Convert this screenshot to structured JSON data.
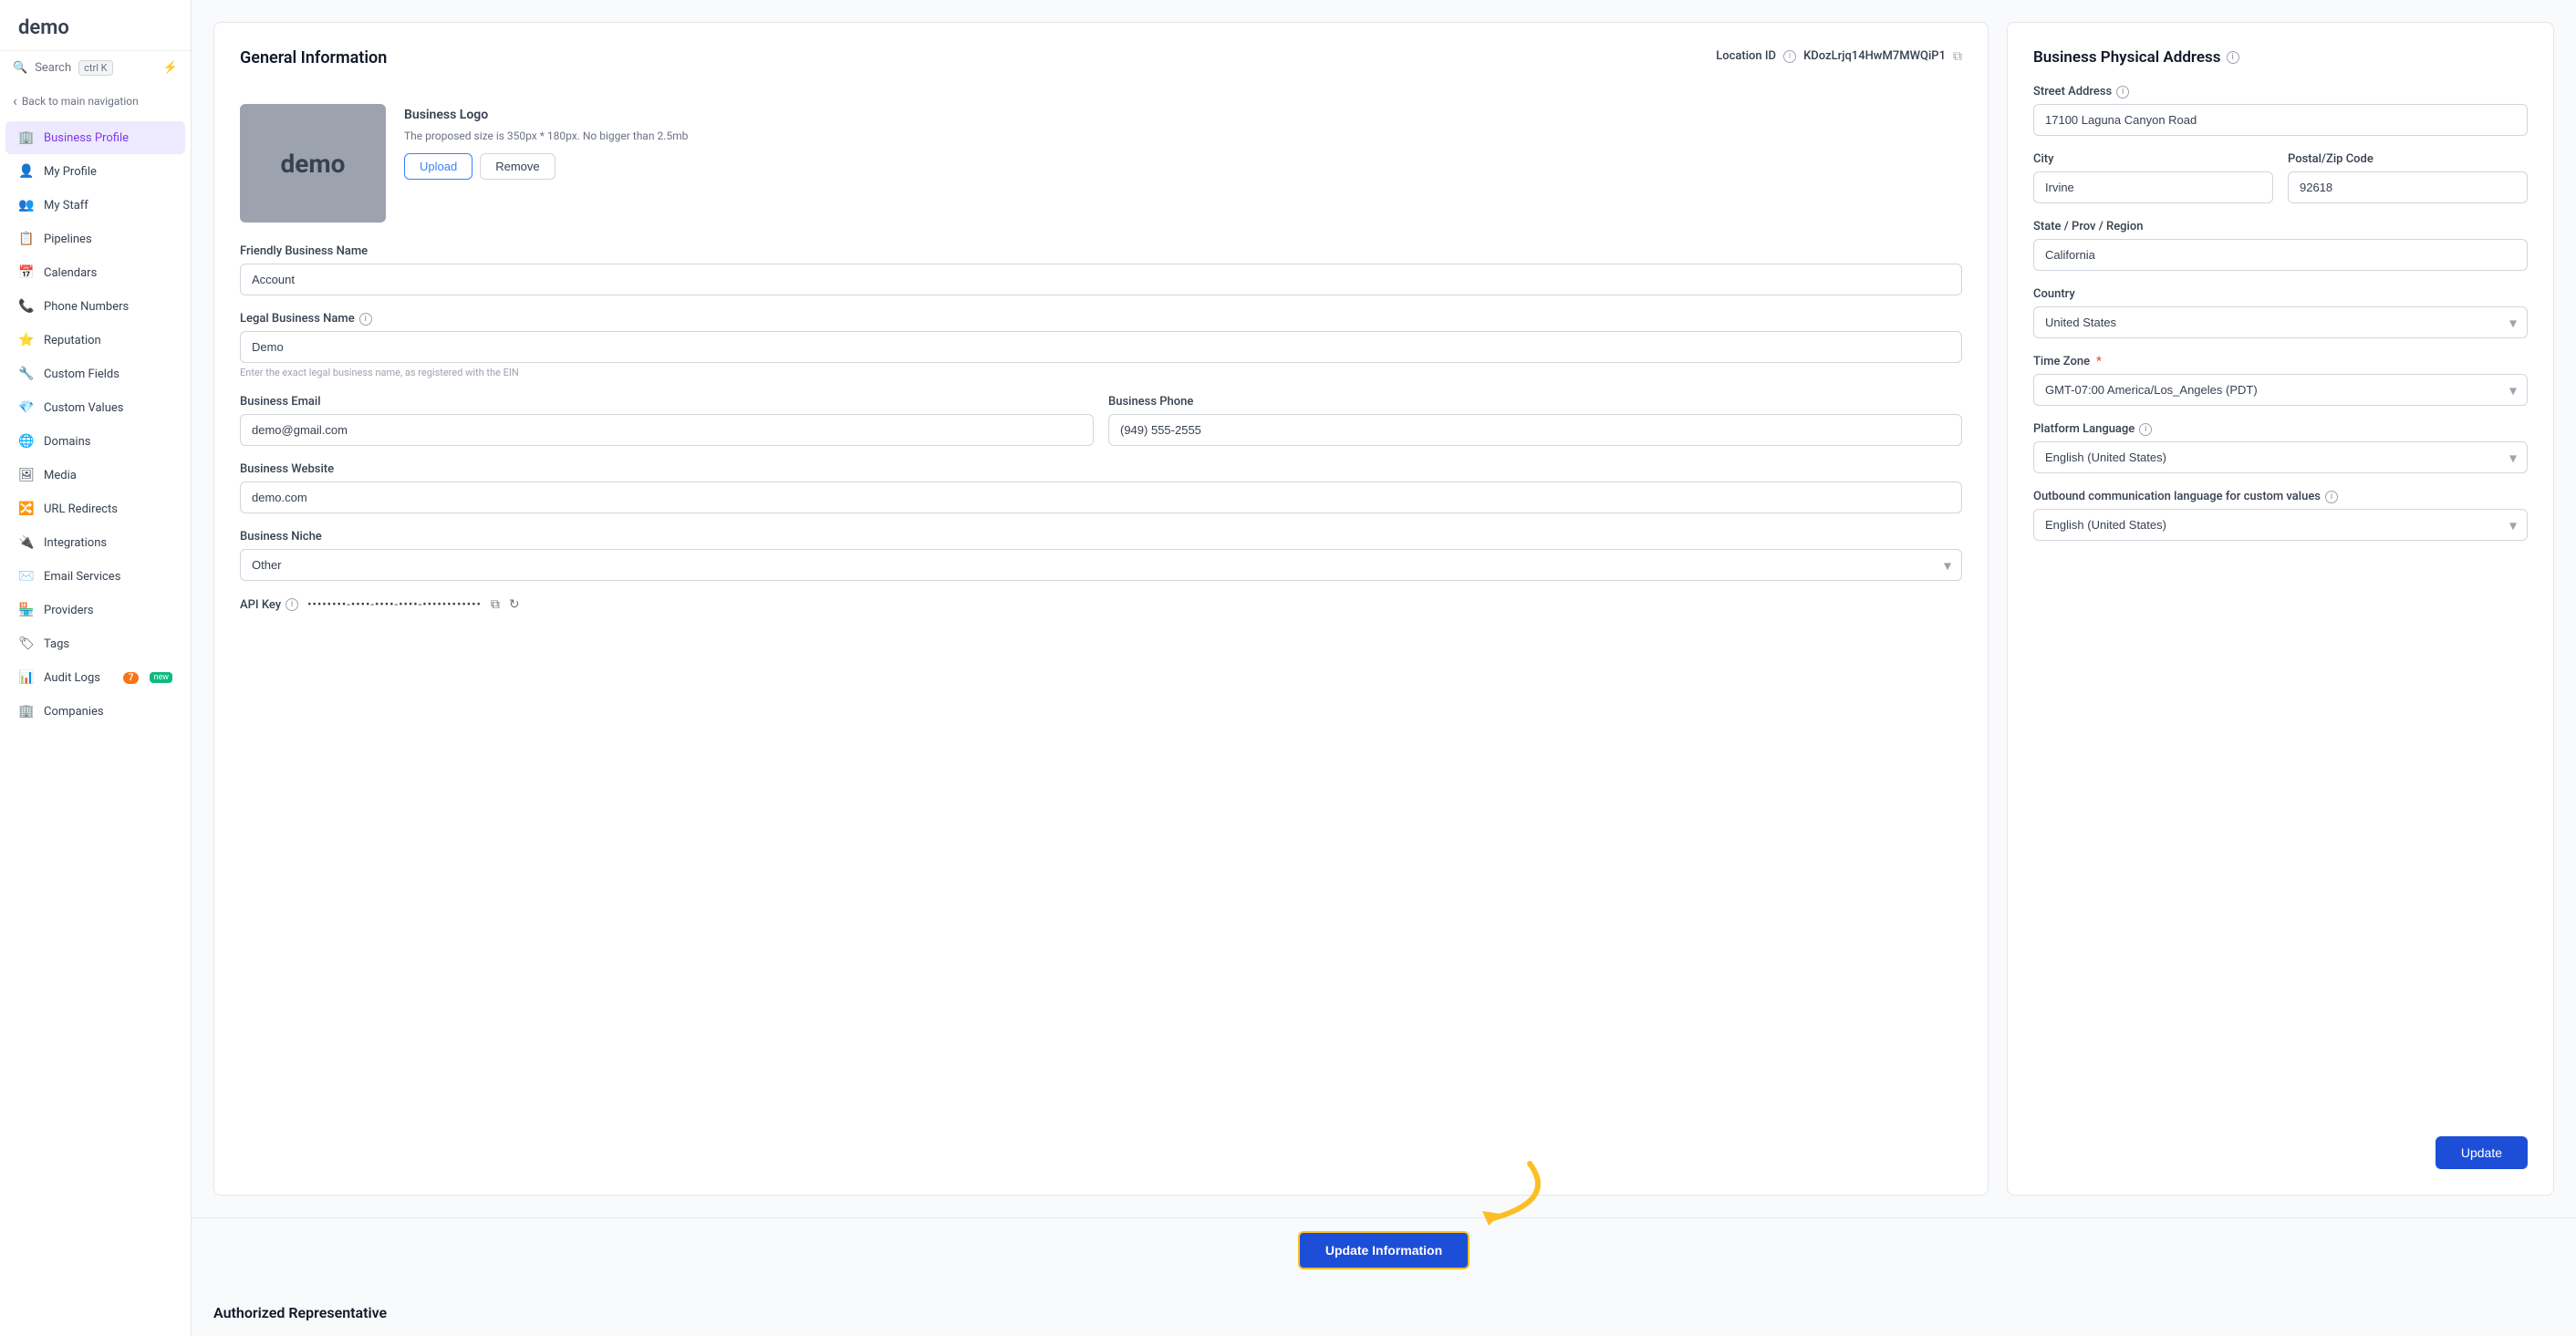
{
  "sidebar": {
    "logo": "demo",
    "search_label": "Search",
    "search_shortcut": "ctrl K",
    "back_label": "Back to main navigation",
    "items": [
      {
        "id": "business-profile",
        "label": "Business Profile",
        "icon": "🏢",
        "active": true
      },
      {
        "id": "my-profile",
        "label": "My Profile",
        "icon": "👤"
      },
      {
        "id": "my-staff",
        "label": "My Staff",
        "icon": "👥"
      },
      {
        "id": "pipelines",
        "label": "Pipelines",
        "icon": "📋"
      },
      {
        "id": "calendars",
        "label": "Calendars",
        "icon": "📅"
      },
      {
        "id": "phone-numbers",
        "label": "Phone Numbers",
        "icon": "📞"
      },
      {
        "id": "reputation",
        "label": "Reputation",
        "icon": "⭐"
      },
      {
        "id": "custom-fields",
        "label": "Custom Fields",
        "icon": "🔧"
      },
      {
        "id": "custom-values",
        "label": "Custom Values",
        "icon": "💎"
      },
      {
        "id": "domains",
        "label": "Domains",
        "icon": "🌐"
      },
      {
        "id": "media",
        "label": "Media",
        "icon": "🖼"
      },
      {
        "id": "url-redirects",
        "label": "URL Redirects",
        "icon": "🔀"
      },
      {
        "id": "integrations",
        "label": "Integrations",
        "icon": "🔌"
      },
      {
        "id": "email-services",
        "label": "Email Services",
        "icon": "✉️"
      },
      {
        "id": "providers",
        "label": "Providers",
        "icon": "🏪"
      },
      {
        "id": "tags",
        "label": "Tags",
        "icon": "🏷"
      },
      {
        "id": "audit-logs",
        "label": "Audit Logs",
        "icon": "📊",
        "badge": "7",
        "badge_new": "new"
      },
      {
        "id": "companies",
        "label": "Companies",
        "icon": "🏢"
      }
    ]
  },
  "general_information": {
    "title": "General Information",
    "location_id_label": "Location ID",
    "location_id_value": "KDozLrjq14HwM7MWQiP1",
    "logo_section": {
      "title": "Business Logo",
      "hint": "The proposed size is 350px * 180px. No bigger than 2.5mb",
      "upload_label": "Upload",
      "remove_label": "Remove",
      "preview_text": "demo"
    },
    "friendly_business_name_label": "Friendly Business Name",
    "friendly_business_name_value": "Account",
    "legal_business_name_label": "Legal Business Name",
    "legal_business_name_value": "Demo",
    "legal_business_name_hint": "Enter the exact legal business name, as registered with the EIN",
    "business_email_label": "Business Email",
    "business_email_value": "demo@gmail.com",
    "business_phone_label": "Business Phone",
    "business_phone_value": "(949) 555-2555",
    "business_website_label": "Business Website",
    "business_website_value": "demo.com",
    "business_niche_label": "Business Niche",
    "business_niche_value": "Other",
    "api_key_label": "API Key",
    "api_key_value": "••••••••-••••-••••-••••-••••••••••••",
    "update_info_label": "Update Information"
  },
  "business_physical_address": {
    "title": "Business Physical Address",
    "street_address_label": "Street Address",
    "street_address_value": "17100 Laguna Canyon Road",
    "city_label": "City",
    "city_value": "Irvine",
    "postal_code_label": "Postal/Zip Code",
    "postal_code_value": "92618",
    "state_label": "State / Prov / Region",
    "state_value": "California",
    "country_label": "Country",
    "country_value": "United States",
    "timezone_label": "Time Zone",
    "timezone_value": "GMT-07:00 America/Los_Angeles (PDT)",
    "platform_language_label": "Platform Language",
    "platform_language_value": "English (United States)",
    "outbound_comm_label": "Outbound communication language for custom values",
    "outbound_comm_value": "English (United States)",
    "update_label": "Update",
    "authorized_rep_label": "Authorized Representative"
  }
}
